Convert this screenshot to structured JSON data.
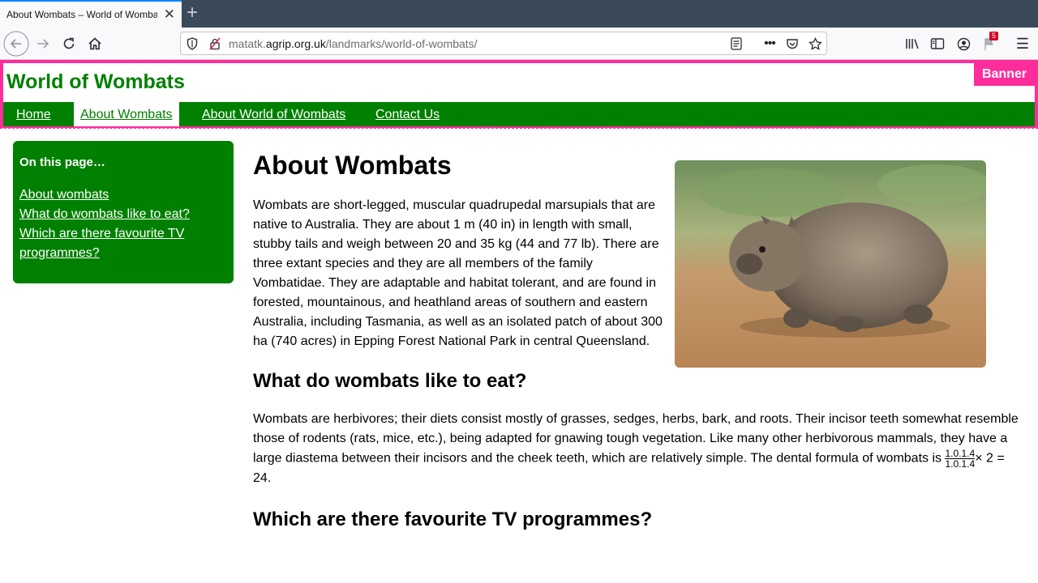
{
  "browser": {
    "tab_title": "About Wombats – World of Wombats",
    "url_host": "matatk.",
    "url_domain": "agrip.org.uk",
    "url_path": "/landmarks/world-of-wombats/",
    "notification_count": "5"
  },
  "banner": {
    "site_title": "World of Wombats",
    "tag": "Banner"
  },
  "nav": {
    "items": [
      {
        "label": "Home"
      },
      {
        "label": "About Wombats"
      },
      {
        "label": "About World of Wombats"
      },
      {
        "label": "Contact Us"
      }
    ]
  },
  "aside": {
    "heading": "On this page…",
    "links": [
      {
        "label": "About wombats"
      },
      {
        "label": "What do wombats like to eat?"
      },
      {
        "label": "Which are there favourite TV programmes?"
      }
    ]
  },
  "main": {
    "title": "About Wombats",
    "intro": "Wombats are short-legged, muscular quadrupedal marsupials that are native to Australia. They are about 1 m (40 in) in length with small, stubby tails and weigh between 20 and 35 kg (44 and 77 lb). There are three extant species and they are all members of the family Vombatidae. They are adaptable and habitat tolerant, and are found in forested, mountainous, and heathland areas of southern and eastern Australia, including Tasmania, as well as an isolated patch of about 300 ha (740 acres) in Epping Forest National Park in central Queensland.",
    "eat_heading": "What do wombats like to eat?",
    "eat_text": "Wombats are herbivores; their diets consist mostly of grasses, sedges, herbs, bark, and roots. Their incisor teeth somewhat resemble those of rodents (rats, mice, etc.), being adapted for gnawing tough vegetation. Like many other herbivorous mammals, they have a large diastema between their incisors and the cheek teeth, which are relatively simple. The dental formula of wombats is",
    "formula_num": "1.0.1.4",
    "formula_den": "1.0.1.4",
    "formula_tail": "× 2 = 24.",
    "tv_heading": "Which are there favourite TV programmes?"
  },
  "colors": {
    "brand_green": "#008000",
    "banner_pink": "#ff2d9b"
  }
}
